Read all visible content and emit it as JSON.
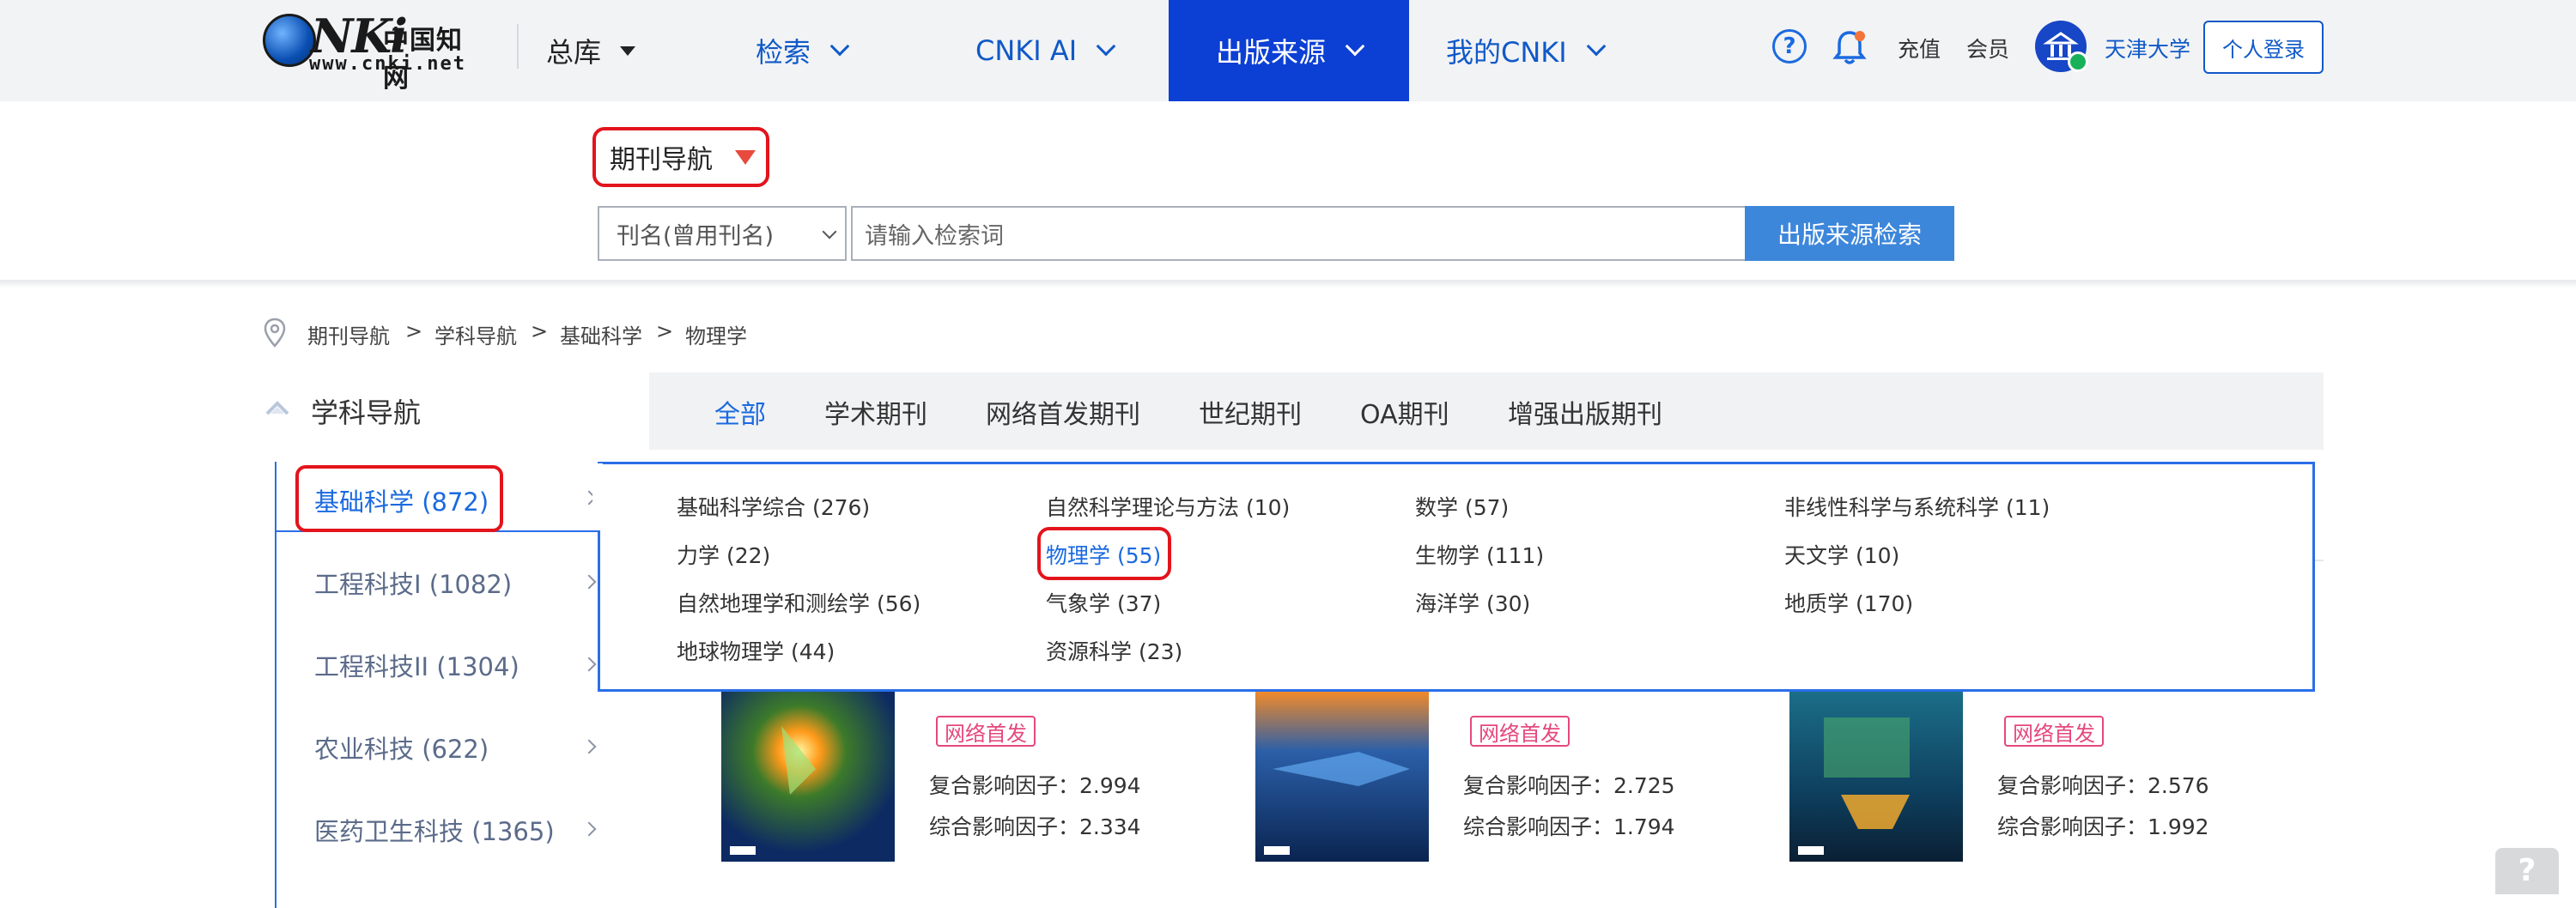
{
  "header": {
    "logo": {
      "cn": "中国知网",
      "url": "www.cnki.net"
    },
    "nav": {
      "zongku": "总库",
      "jiansuo": "检索",
      "cnki_ai": "CNKI AI",
      "pub_source": "出版来源",
      "my_cnki": "我的CNKI"
    },
    "links": {
      "recharge": "充值",
      "member": "会员",
      "university": "天津大学",
      "login": "个人登录"
    }
  },
  "search": {
    "journal_nav": "期刊导航",
    "field_select": "刊名(曾用刊名)",
    "placeholder": "请输入检索词",
    "button": "出版来源检索"
  },
  "breadcrumb": [
    "期刊导航",
    "学科导航",
    "基础科学",
    "物理学"
  ],
  "subject_nav": {
    "title": "学科导航",
    "tabs": [
      "全部",
      "学术期刊",
      "网络首发期刊",
      "世纪期刊",
      "OA期刊",
      "增强出版期刊"
    ],
    "categories": [
      "基础科学 (872)",
      "工程科技I (1082)",
      "工程科技II (1304)",
      "农业科技 (622)",
      "医药卫生科技 (1365)"
    ],
    "subcategories": [
      "基础科学综合 (276)",
      "自然科学理论与方法 (10)",
      "数学 (57)",
      "非线性科学与系统科学 (11)",
      "力学 (22)",
      "物理学 (55)",
      "生物学 (111)",
      "天文学 (10)",
      "自然地理学和测绘学 (56)",
      "气象学 (37)",
      "海洋学 (30)",
      "地质学 (170)",
      "地球物理学 (44)",
      "资源科学 (23)"
    ]
  },
  "journals": [
    {
      "badge": "网络首发",
      "fuhe_label": "复合影响因子：",
      "fuhe": "2.994",
      "zonghe_label": "综合影响因子：",
      "zonghe": "2.334"
    },
    {
      "badge": "网络首发",
      "fuhe_label": "复合影响因子：",
      "fuhe": "2.725",
      "zonghe_label": "综合影响因子：",
      "zonghe": "1.794"
    },
    {
      "badge": "网络首发",
      "fuhe_label": "复合影响因子：",
      "fuhe": "2.576",
      "zonghe_label": "综合影响因子：",
      "zonghe": "1.992"
    }
  ],
  "colors": {
    "brand_blue": "#0c3fd4",
    "link_blue": "#1a6ae0",
    "highlight_red": "#e3141c",
    "badge_pink": "#e5487c"
  }
}
